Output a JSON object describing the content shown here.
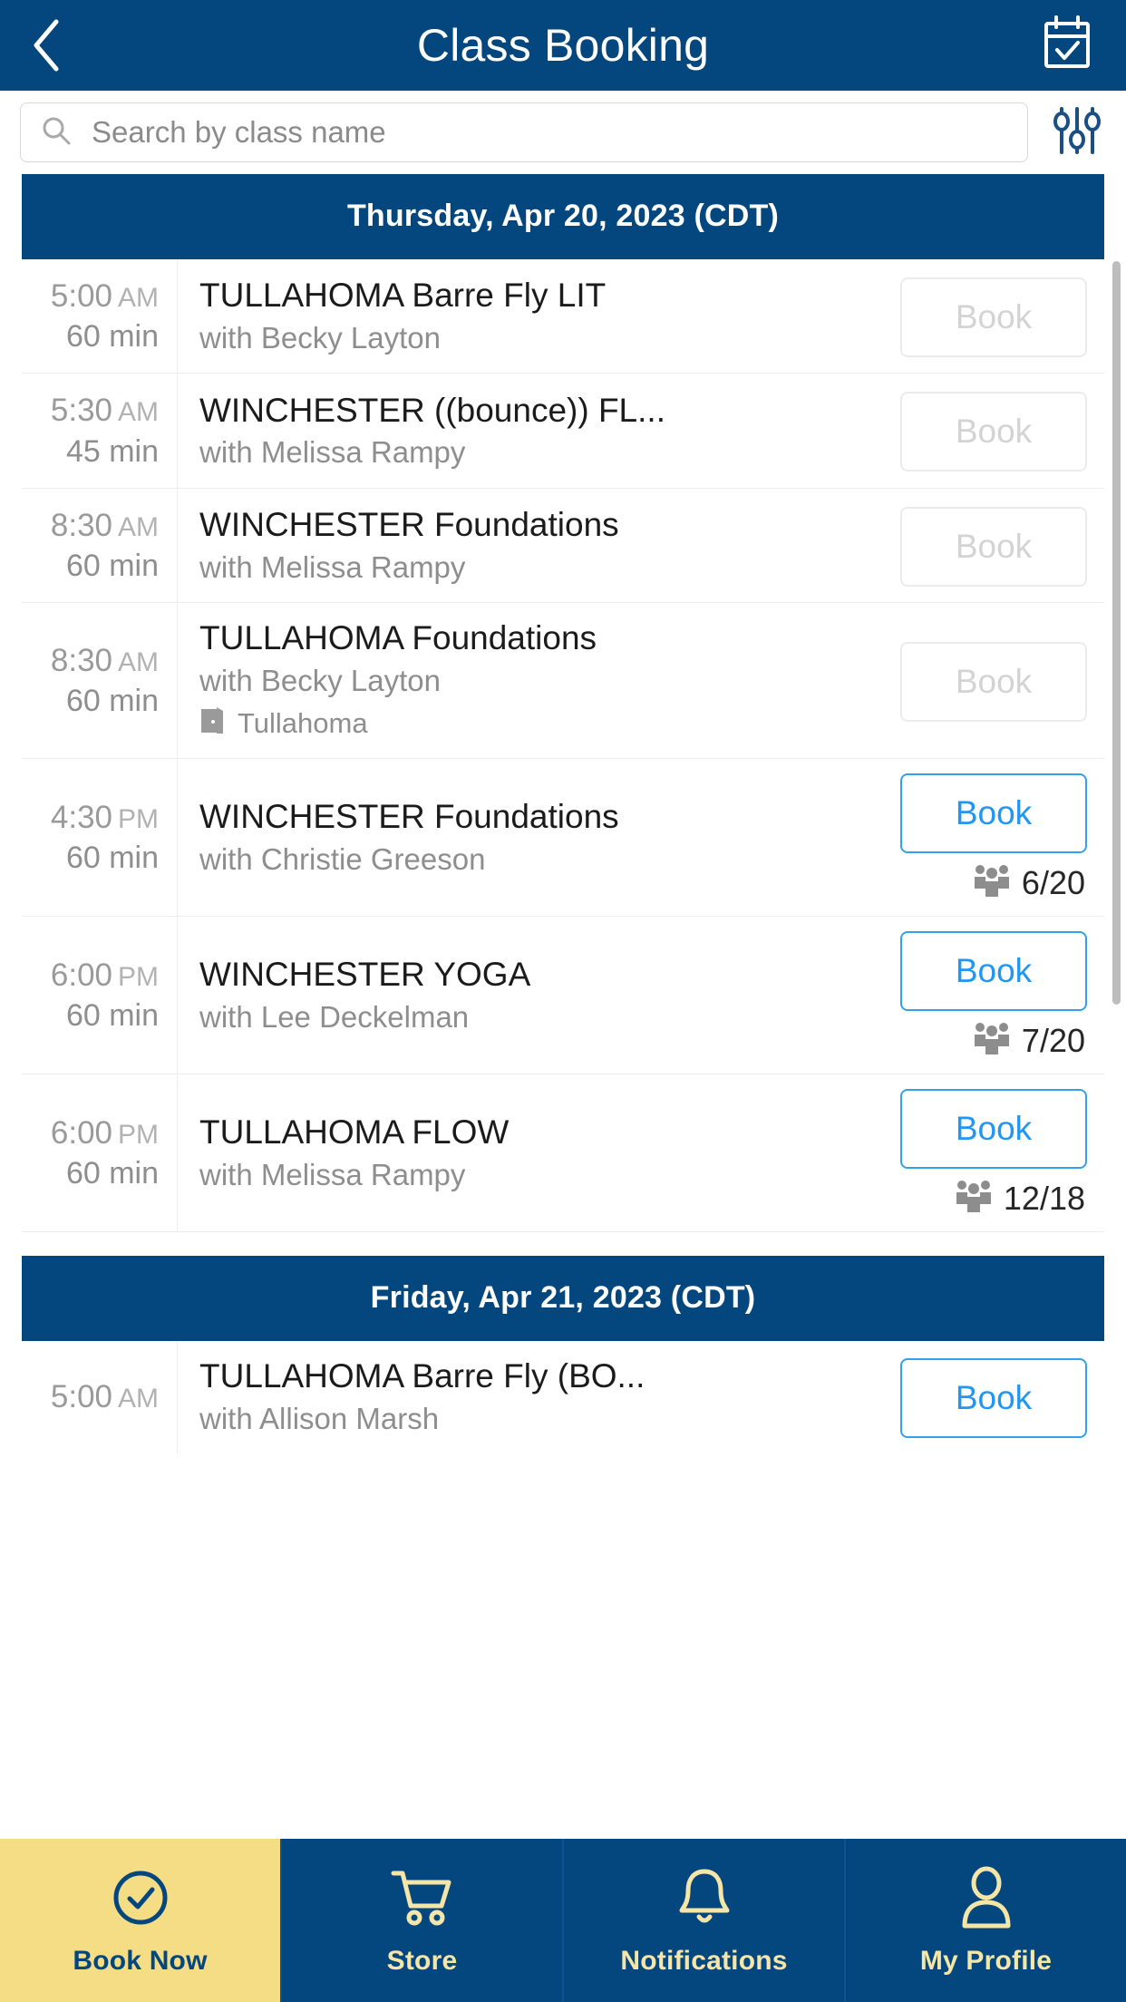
{
  "header": {
    "title": "Class Booking",
    "back_icon": "chevron-left-icon",
    "calendar_icon": "calendar-check-icon"
  },
  "search": {
    "placeholder": "Search by class name",
    "value": "",
    "search_icon": "search-icon",
    "filter_icon": "sliders-filter-icon"
  },
  "days": [
    {
      "label": "Thursday, Apr 20, 2023 (CDT)",
      "classes": [
        {
          "time": "5:00",
          "meridiem": "AM",
          "duration": "60 min",
          "name": "TULLAHOMA Barre Fly LIT",
          "coach": "with Becky Layton",
          "room": "",
          "book_label": "Book",
          "book_enabled": false,
          "attendance": ""
        },
        {
          "time": "5:30",
          "meridiem": "AM",
          "duration": "45 min",
          "name": "WINCHESTER ((bounce)) FL...",
          "coach": "with Melissa Rampy",
          "room": "",
          "book_label": "Book",
          "book_enabled": false,
          "attendance": ""
        },
        {
          "time": "8:30",
          "meridiem": "AM",
          "duration": "60 min",
          "name": "WINCHESTER Foundations",
          "coach": "with Melissa Rampy",
          "room": "",
          "book_label": "Book",
          "book_enabled": false,
          "attendance": ""
        },
        {
          "time": "8:30",
          "meridiem": "AM",
          "duration": "60 min",
          "name": "TULLAHOMA Foundations",
          "coach": "with Becky Layton",
          "room": "Tullahoma",
          "book_label": "Book",
          "book_enabled": false,
          "attendance": ""
        },
        {
          "time": "4:30",
          "meridiem": "PM",
          "duration": "60 min",
          "name": "WINCHESTER Foundations",
          "coach": "with Christie Greeson",
          "room": "",
          "book_label": "Book",
          "book_enabled": true,
          "attendance": "6/20"
        },
        {
          "time": "6:00",
          "meridiem": "PM",
          "duration": "60 min",
          "name": "WINCHESTER YOGA",
          "coach": "with Lee Deckelman",
          "room": "",
          "book_label": "Book",
          "book_enabled": true,
          "attendance": "7/20"
        },
        {
          "time": "6:00",
          "meridiem": "PM",
          "duration": "60 min",
          "name": "TULLAHOMA FLOW",
          "coach": "with Melissa Rampy",
          "room": "",
          "book_label": "Book",
          "book_enabled": true,
          "attendance": "12/18"
        }
      ]
    },
    {
      "label": "Friday, Apr 21, 2023 (CDT)",
      "classes": [
        {
          "time": "5:00",
          "meridiem": "AM",
          "duration": "",
          "name": "TULLAHOMA Barre Fly (BO...",
          "coach": "with Allison Marsh",
          "room": "",
          "book_label": "Book",
          "book_enabled": true,
          "attendance": ""
        }
      ]
    }
  ],
  "bottom_nav": [
    {
      "label": "Book Now",
      "icon": "check-circle-icon",
      "active": true
    },
    {
      "label": "Store",
      "icon": "shopping-cart-icon",
      "active": false
    },
    {
      "label": "Notifications",
      "icon": "bell-icon",
      "active": false
    },
    {
      "label": "My Profile",
      "icon": "user-icon",
      "active": false
    }
  ],
  "colors": {
    "brand_navy": "#04477f",
    "accent_yellow": "#f5dd86",
    "link_blue": "#2196f3",
    "disabled_grey": "#d3d3d3"
  }
}
